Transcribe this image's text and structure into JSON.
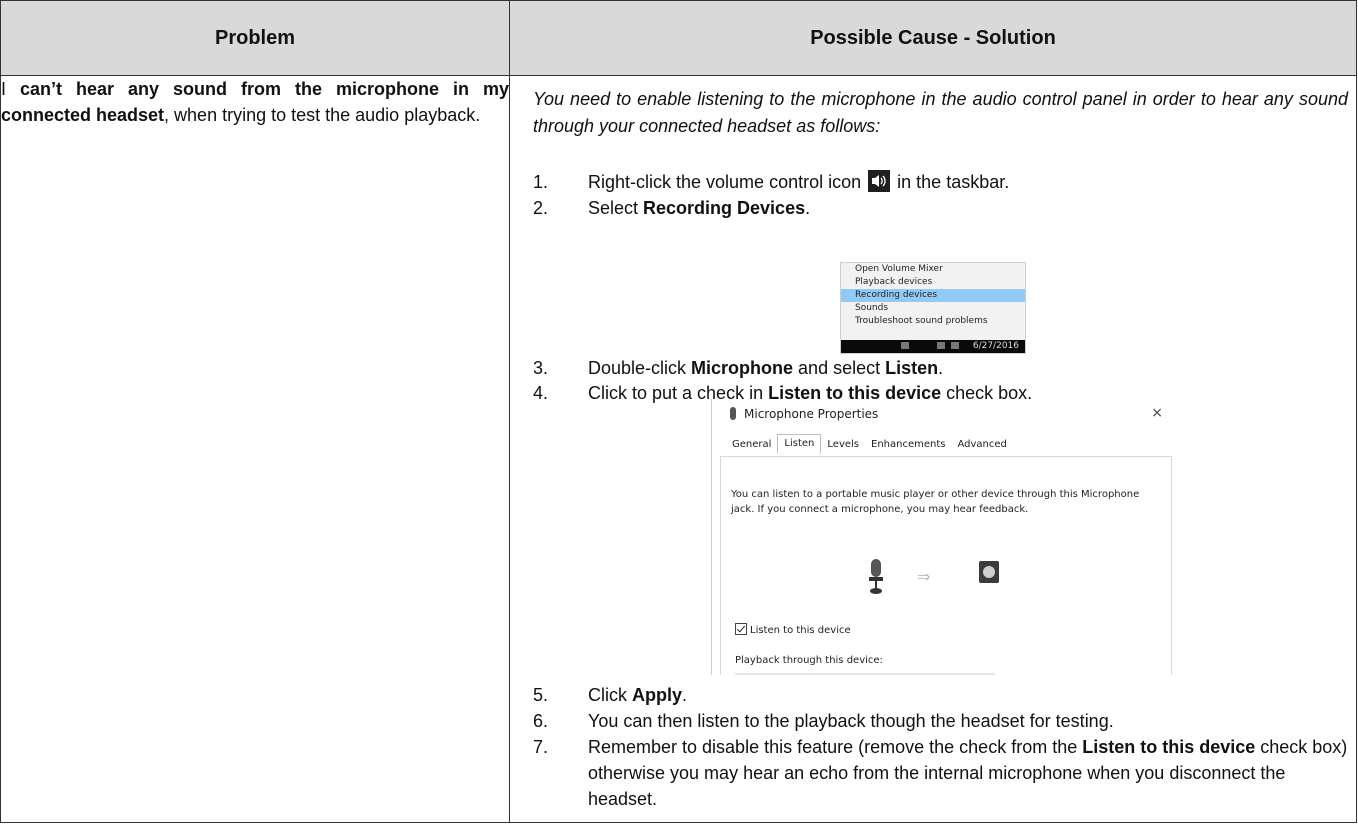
{
  "header": {
    "problem": "Problem",
    "solution": "Possible Cause - Solution"
  },
  "problem": {
    "p1": "I ",
    "p2": "can’t hear any sound from the microphone in my connected headset",
    "p3": ", when trying to test the audio playback."
  },
  "solution": {
    "intro": "You need to enable listening to the microphone in the audio control panel in order to hear any sound through your connected headset as follows:",
    "steps": [
      {
        "num": "1.",
        "a": "Right-click the volume control icon",
        "b": "in the taskbar."
      },
      {
        "num": "2.",
        "a": "Select ",
        "b": "Recording Devices",
        "c": "."
      },
      {
        "num": "3.",
        "a": "Double-click ",
        "b": "Microphone",
        "c": " and select ",
        "d": "Listen",
        "e": "."
      },
      {
        "num": "4.",
        "a": "Click to put a check in ",
        "b": "Listen to this device",
        "c": " check box."
      },
      {
        "num": "5.",
        "a": "Click ",
        "b": "Apply",
        "c": "."
      },
      {
        "num": "6.",
        "a": "You can then listen to the playback though the headset for testing."
      },
      {
        "num": "7.",
        "a": "Remember to disable this feature (remove the check from the ",
        "b": "Listen to this device",
        "c": " check box) otherwise you may hear an echo from the internal microphone when you disconnect the headset."
      }
    ]
  },
  "context_menu": {
    "items": [
      "Open Volume Mixer",
      "Playback devices",
      "Recording devices",
      "Sounds",
      "Troubleshoot sound problems"
    ],
    "selected": "Recording devices",
    "date": "6/27/2016",
    "highlight_color": "#91c9f7"
  },
  "mic_props": {
    "title": "Microphone Properties",
    "close": "×",
    "tabs": [
      "General",
      "Listen",
      "Levels",
      "Enhancements",
      "Advanced"
    ],
    "active_tab": "Listen",
    "description": "You can listen to a portable music player or other device through this Microphone jack.  If you connect a microphone, you may hear feedback.",
    "checkbox_label": "Listen to this device",
    "checkbox_checked": true,
    "playback_label": "Playback through this device:"
  }
}
